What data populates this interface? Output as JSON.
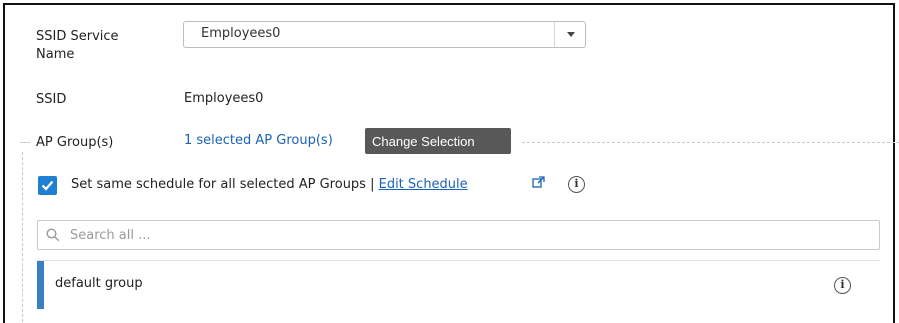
{
  "ssid_service_name": {
    "label": "SSID Service\nName",
    "label_line1": "SSID Service",
    "label_line2": "Name",
    "selected_value": "Employees0"
  },
  "ssid": {
    "label": "SSID",
    "value": "Employees0"
  },
  "ap_groups": {
    "label": "AP Group(s)",
    "selected_text": "1 selected AP Group(s)",
    "change_button": "Change Selection"
  },
  "schedule": {
    "checked": true,
    "text": "Set same schedule for all selected AP Groups |",
    "edit_link": "Edit Schedule"
  },
  "search": {
    "placeholder": "Search all ..."
  },
  "groups": [
    {
      "name": "default group"
    }
  ],
  "colors": {
    "accent": "#3a7ec4",
    "link": "#1a62b7",
    "checkbox": "#1f7fd0",
    "button_bg": "#585858"
  },
  "icons": [
    "chevron-down-icon",
    "check-icon",
    "external-link-icon",
    "info-icon",
    "search-icon"
  ]
}
